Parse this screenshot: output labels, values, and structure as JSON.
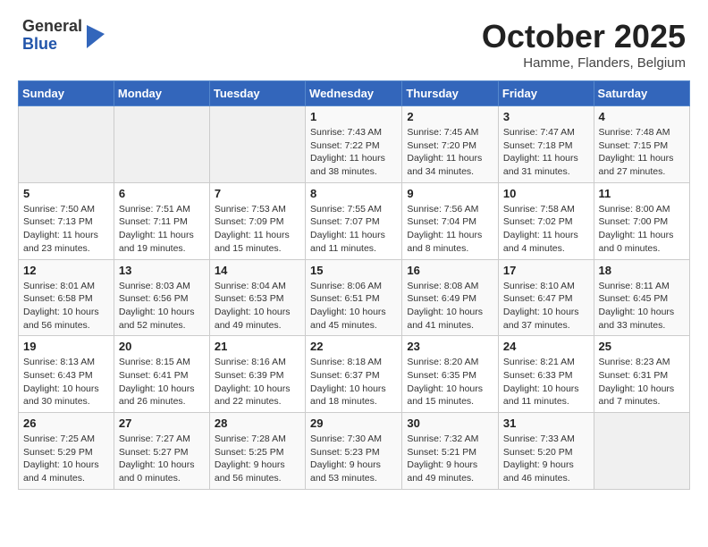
{
  "header": {
    "logo_general": "General",
    "logo_blue": "Blue",
    "month_title": "October 2025",
    "location": "Hamme, Flanders, Belgium"
  },
  "days_of_week": [
    "Sunday",
    "Monday",
    "Tuesday",
    "Wednesday",
    "Thursday",
    "Friday",
    "Saturday"
  ],
  "weeks": [
    [
      {
        "day": "",
        "info": ""
      },
      {
        "day": "",
        "info": ""
      },
      {
        "day": "",
        "info": ""
      },
      {
        "day": "1",
        "info": "Sunrise: 7:43 AM\nSunset: 7:22 PM\nDaylight: 11 hours\nand 38 minutes."
      },
      {
        "day": "2",
        "info": "Sunrise: 7:45 AM\nSunset: 7:20 PM\nDaylight: 11 hours\nand 34 minutes."
      },
      {
        "day": "3",
        "info": "Sunrise: 7:47 AM\nSunset: 7:18 PM\nDaylight: 11 hours\nand 31 minutes."
      },
      {
        "day": "4",
        "info": "Sunrise: 7:48 AM\nSunset: 7:15 PM\nDaylight: 11 hours\nand 27 minutes."
      }
    ],
    [
      {
        "day": "5",
        "info": "Sunrise: 7:50 AM\nSunset: 7:13 PM\nDaylight: 11 hours\nand 23 minutes."
      },
      {
        "day": "6",
        "info": "Sunrise: 7:51 AM\nSunset: 7:11 PM\nDaylight: 11 hours\nand 19 minutes."
      },
      {
        "day": "7",
        "info": "Sunrise: 7:53 AM\nSunset: 7:09 PM\nDaylight: 11 hours\nand 15 minutes."
      },
      {
        "day": "8",
        "info": "Sunrise: 7:55 AM\nSunset: 7:07 PM\nDaylight: 11 hours\nand 11 minutes."
      },
      {
        "day": "9",
        "info": "Sunrise: 7:56 AM\nSunset: 7:04 PM\nDaylight: 11 hours\nand 8 minutes."
      },
      {
        "day": "10",
        "info": "Sunrise: 7:58 AM\nSunset: 7:02 PM\nDaylight: 11 hours\nand 4 minutes."
      },
      {
        "day": "11",
        "info": "Sunrise: 8:00 AM\nSunset: 7:00 PM\nDaylight: 11 hours\nand 0 minutes."
      }
    ],
    [
      {
        "day": "12",
        "info": "Sunrise: 8:01 AM\nSunset: 6:58 PM\nDaylight: 10 hours\nand 56 minutes."
      },
      {
        "day": "13",
        "info": "Sunrise: 8:03 AM\nSunset: 6:56 PM\nDaylight: 10 hours\nand 52 minutes."
      },
      {
        "day": "14",
        "info": "Sunrise: 8:04 AM\nSunset: 6:53 PM\nDaylight: 10 hours\nand 49 minutes."
      },
      {
        "day": "15",
        "info": "Sunrise: 8:06 AM\nSunset: 6:51 PM\nDaylight: 10 hours\nand 45 minutes."
      },
      {
        "day": "16",
        "info": "Sunrise: 8:08 AM\nSunset: 6:49 PM\nDaylight: 10 hours\nand 41 minutes."
      },
      {
        "day": "17",
        "info": "Sunrise: 8:10 AM\nSunset: 6:47 PM\nDaylight: 10 hours\nand 37 minutes."
      },
      {
        "day": "18",
        "info": "Sunrise: 8:11 AM\nSunset: 6:45 PM\nDaylight: 10 hours\nand 33 minutes."
      }
    ],
    [
      {
        "day": "19",
        "info": "Sunrise: 8:13 AM\nSunset: 6:43 PM\nDaylight: 10 hours\nand 30 minutes."
      },
      {
        "day": "20",
        "info": "Sunrise: 8:15 AM\nSunset: 6:41 PM\nDaylight: 10 hours\nand 26 minutes."
      },
      {
        "day": "21",
        "info": "Sunrise: 8:16 AM\nSunset: 6:39 PM\nDaylight: 10 hours\nand 22 minutes."
      },
      {
        "day": "22",
        "info": "Sunrise: 8:18 AM\nSunset: 6:37 PM\nDaylight: 10 hours\nand 18 minutes."
      },
      {
        "day": "23",
        "info": "Sunrise: 8:20 AM\nSunset: 6:35 PM\nDaylight: 10 hours\nand 15 minutes."
      },
      {
        "day": "24",
        "info": "Sunrise: 8:21 AM\nSunset: 6:33 PM\nDaylight: 10 hours\nand 11 minutes."
      },
      {
        "day": "25",
        "info": "Sunrise: 8:23 AM\nSunset: 6:31 PM\nDaylight: 10 hours\nand 7 minutes."
      }
    ],
    [
      {
        "day": "26",
        "info": "Sunrise: 7:25 AM\nSunset: 5:29 PM\nDaylight: 10 hours\nand 4 minutes."
      },
      {
        "day": "27",
        "info": "Sunrise: 7:27 AM\nSunset: 5:27 PM\nDaylight: 10 hours\nand 0 minutes."
      },
      {
        "day": "28",
        "info": "Sunrise: 7:28 AM\nSunset: 5:25 PM\nDaylight: 9 hours\nand 56 minutes."
      },
      {
        "day": "29",
        "info": "Sunrise: 7:30 AM\nSunset: 5:23 PM\nDaylight: 9 hours\nand 53 minutes."
      },
      {
        "day": "30",
        "info": "Sunrise: 7:32 AM\nSunset: 5:21 PM\nDaylight: 9 hours\nand 49 minutes."
      },
      {
        "day": "31",
        "info": "Sunrise: 7:33 AM\nSunset: 5:20 PM\nDaylight: 9 hours\nand 46 minutes."
      },
      {
        "day": "",
        "info": ""
      }
    ]
  ]
}
